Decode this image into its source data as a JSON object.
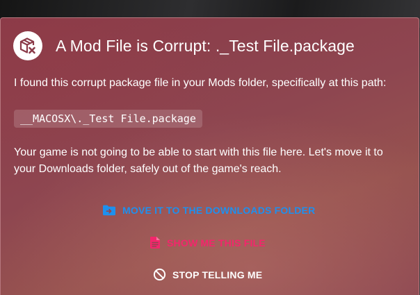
{
  "dialog": {
    "title": "A Mod File is Corrupt: ._Test File.package",
    "icon": "package-corrupt-icon",
    "message_part1": "I found this corrupt package file in your Mods folder, specifically at this path:",
    "file_path": "__MACOSX\\._Test File.package",
    "message_part2": "Your game is not going to be able to start with this file here. Let's move it to your Downloads folder, safely out of the game's reach."
  },
  "actions": {
    "move": {
      "label": "MOVE IT TO THE DOWNLOADS FOLDER",
      "icon": "folder-move-icon",
      "color": "#1e90ee"
    },
    "show": {
      "label": "SHOW ME THIS FILE",
      "icon": "file-document-icon",
      "color": "#f3266c"
    },
    "stop": {
      "label": "STOP TELLING ME",
      "icon": "cancel-circle-icon",
      "color": "#ffffff"
    }
  }
}
